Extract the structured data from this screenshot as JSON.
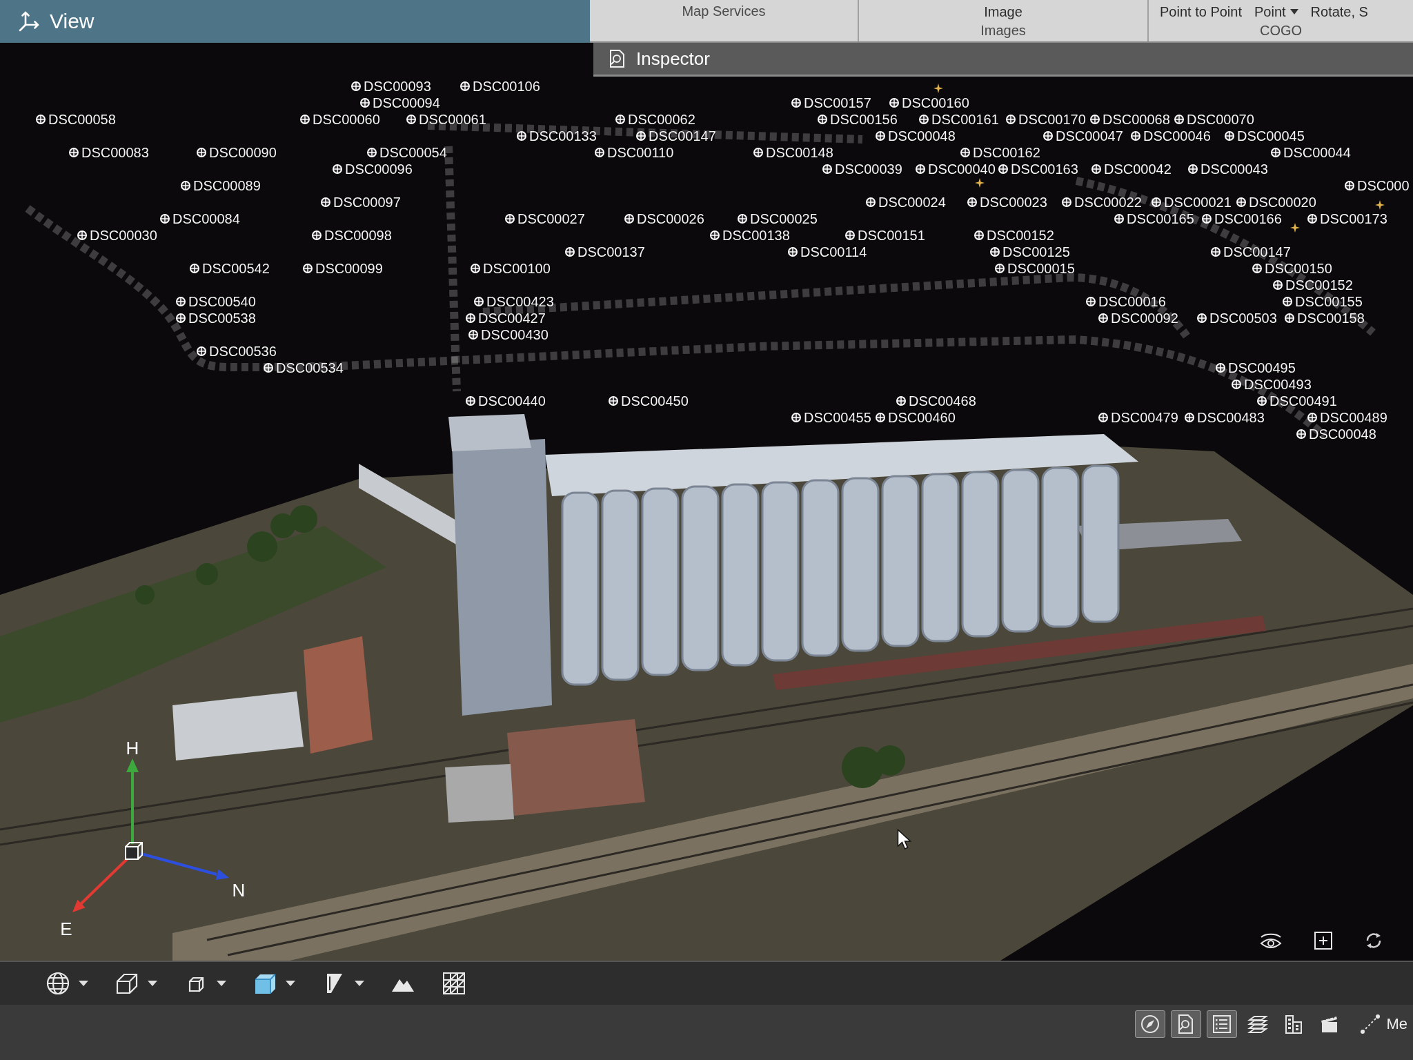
{
  "view_panel": {
    "title": "View"
  },
  "ribbon": {
    "groups": [
      {
        "label": "Map Services"
      },
      {
        "label": "Images",
        "buttons": [
          {
            "label": "Image",
            "dropdown": false
          }
        ]
      },
      {
        "label": "COGO",
        "buttons": [
          {
            "label": "Point to Point",
            "dropdown": false
          },
          {
            "label": "Point",
            "dropdown": true
          },
          {
            "label": "Rotate, S",
            "dropdown": false
          }
        ]
      }
    ]
  },
  "inspector": {
    "title": "Inspector"
  },
  "viewport": {
    "cameras": [
      {
        "label": "DSC00093"
      },
      {
        "label": "DSC00106"
      },
      {
        "label": "DSC00094"
      },
      {
        "label": "DSC00157"
      },
      {
        "label": "DSC00160"
      },
      {
        "label": "DSC00058"
      },
      {
        "label": "DSC00060"
      },
      {
        "label": "DSC00061"
      },
      {
        "label": "DSC00062"
      },
      {
        "label": "DSC00156"
      },
      {
        "label": "DSC00161"
      },
      {
        "label": "DSC00170"
      },
      {
        "label": "DSC00068"
      },
      {
        "label": "DSC00070"
      },
      {
        "label": "DSC00133"
      },
      {
        "label": "DSC00147"
      },
      {
        "label": "DSC00048"
      },
      {
        "label": "DSC00047"
      },
      {
        "label": "DSC00046"
      },
      {
        "label": "DSC00045"
      },
      {
        "label": "DSC00083"
      },
      {
        "label": "DSC00090"
      },
      {
        "label": "DSC00054"
      },
      {
        "label": "DSC00110"
      },
      {
        "label": "DSC00148"
      },
      {
        "label": "DSC00162"
      },
      {
        "label": "DSC00044"
      },
      {
        "label": "DSC00096"
      },
      {
        "label": "DSC00039"
      },
      {
        "label": "DSC00040"
      },
      {
        "label": "DSC00163"
      },
      {
        "label": "DSC00042"
      },
      {
        "label": "DSC00043"
      },
      {
        "label": "DSC00089"
      },
      {
        "label": "DSC000"
      },
      {
        "label": "DSC00097"
      },
      {
        "label": "DSC00024"
      },
      {
        "label": "DSC00023"
      },
      {
        "label": "DSC00022"
      },
      {
        "label": "DSC00021"
      },
      {
        "label": "DSC00020"
      },
      {
        "label": "DSC00084"
      },
      {
        "label": "DSC00027"
      },
      {
        "label": "DSC00026"
      },
      {
        "label": "DSC00025"
      },
      {
        "label": "DSC00165"
      },
      {
        "label": "DSC00166"
      },
      {
        "label": "DSC00173"
      },
      {
        "label": "DSC00030"
      },
      {
        "label": "DSC00098"
      },
      {
        "label": "DSC00138"
      },
      {
        "label": "DSC00151"
      },
      {
        "label": "DSC00152"
      },
      {
        "label": "DSC00137"
      },
      {
        "label": "DSC00114"
      },
      {
        "label": "DSC00125"
      },
      {
        "label": "DSC00147"
      },
      {
        "label": "DSC00542"
      },
      {
        "label": "DSC00099"
      },
      {
        "label": "DSC00100"
      },
      {
        "label": "DSC00015"
      },
      {
        "label": "DSC00150"
      },
      {
        "label": "DSC00152"
      },
      {
        "label": "DSC00540"
      },
      {
        "label": "DSC00423"
      },
      {
        "label": "DSC00016"
      },
      {
        "label": "DSC00155"
      },
      {
        "label": "DSC00538"
      },
      {
        "label": "DSC00427"
      },
      {
        "label": "DSC00092"
      },
      {
        "label": "DSC00503"
      },
      {
        "label": "DSC00158"
      },
      {
        "label": "DSC00430"
      },
      {
        "label": "DSC00536"
      },
      {
        "label": "DSC00534"
      },
      {
        "label": "DSC00495"
      },
      {
        "label": "DSC00493"
      },
      {
        "label": "DSC00440"
      },
      {
        "label": "DSC00450"
      },
      {
        "label": "DSC00468"
      },
      {
        "label": "DSC00491"
      },
      {
        "label": "DSC00455"
      },
      {
        "label": "DSC00460"
      },
      {
        "label": "DSC00479"
      },
      {
        "label": "DSC00483"
      },
      {
        "label": "DSC00489"
      },
      {
        "label": "DSC00048"
      }
    ],
    "axes": [
      {
        "label": "H",
        "color": "#3da83d"
      },
      {
        "label": "N",
        "color": "#2d4fe0"
      },
      {
        "label": "E",
        "color": "#e23a32"
      }
    ]
  },
  "toolbar": {
    "tools": [
      {
        "dropdown": true
      },
      {
        "dropdown": true
      },
      {
        "dropdown": true
      },
      {
        "dropdown": true
      },
      {
        "dropdown": true
      },
      {
        "dropdown": false
      },
      {
        "dropdown": false
      }
    ]
  },
  "status_bar": {
    "buttons": [
      {
        "selected": true
      },
      {
        "selected": true
      },
      {
        "selected": true
      },
      {
        "selected": false
      },
      {
        "selected": false
      },
      {
        "selected": false
      }
    ],
    "measure": {
      "label": "Me"
    }
  }
}
